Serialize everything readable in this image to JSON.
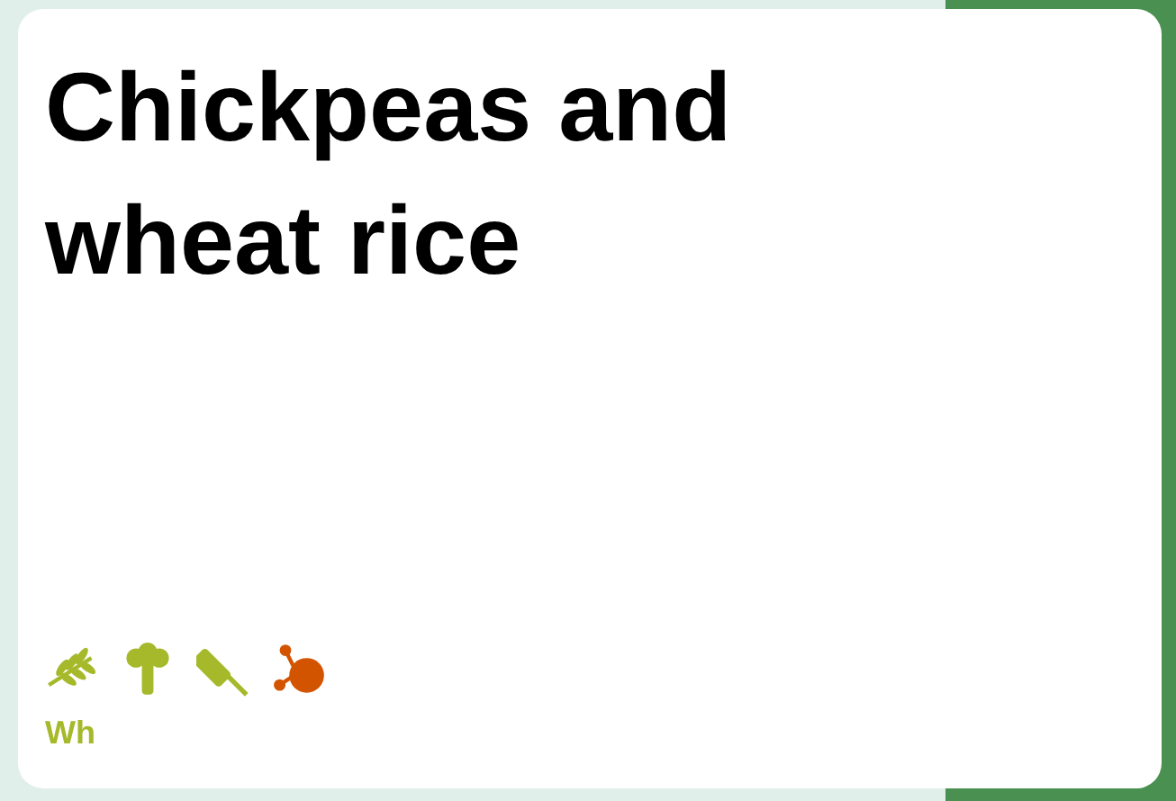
{
  "card": {
    "title": "Chickpeas and wheat rice",
    "icons": [
      {
        "kind": "wheat",
        "color": "#a5b92a"
      },
      {
        "kind": "broccoli",
        "color": "#a5b92a"
      },
      {
        "kind": "bottle",
        "color": "#a5b92a"
      },
      {
        "kind": "molecule",
        "color": "#d35400"
      }
    ],
    "caption": "Wh"
  }
}
